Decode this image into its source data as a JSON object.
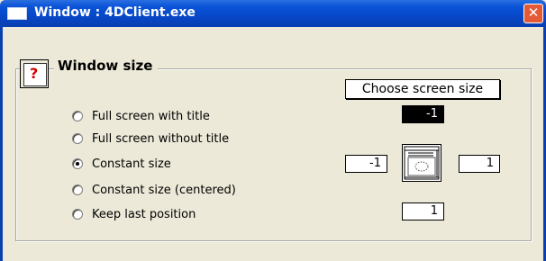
{
  "window": {
    "title": "Window : 4DClient.exe",
    "close_glyph": "✕"
  },
  "group": {
    "title": "Window size",
    "icon_glyph": "?"
  },
  "radios": [
    {
      "label": "Full screen with title",
      "checked": false
    },
    {
      "label": "Full screen without title",
      "checked": false
    },
    {
      "label": "Constant size",
      "checked": true
    },
    {
      "label": "Constant size (centered)",
      "checked": false
    },
    {
      "label": "Keep last position",
      "checked": false
    }
  ],
  "controls": {
    "choose_screen_label": "Choose screen size",
    "screen_number": "-1",
    "width_value": "-1",
    "height_value": "1",
    "last_position_value": "1"
  }
}
